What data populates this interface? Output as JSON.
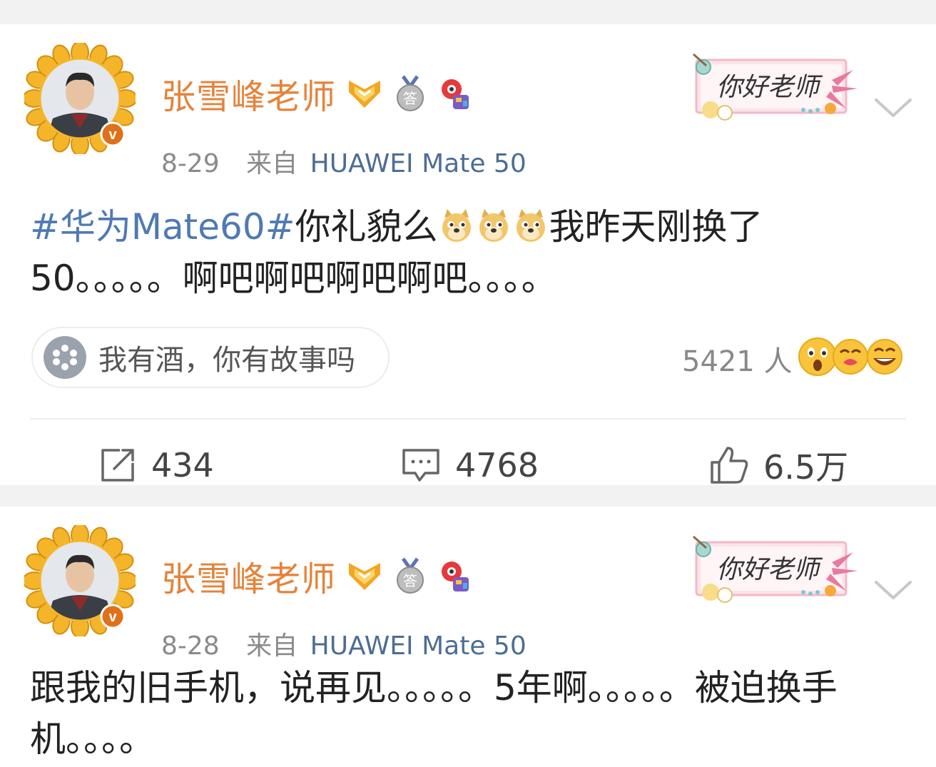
{
  "posts": [
    {
      "username": "张雪峰老师",
      "date": "8-29",
      "source_prefix": "来自",
      "device": "HUAWEI Mate 50",
      "text_hashtag": "#华为Mate60#",
      "text_part1": "你礼貌么",
      "text_part2": "我昨天刚换了50。。。。。啊吧啊吧啊吧啊吧。。。。",
      "sticker_text": "你好老师",
      "tag_text": "我有酒，你有故事吗",
      "reaction_count": "5421 人",
      "repost_count": "434",
      "comment_count": "4768",
      "like_count": "6.5万"
    },
    {
      "username": "张雪峰老师",
      "date": "8-28",
      "source_prefix": "来自",
      "device": "HUAWEI Mate 50",
      "text": "跟我的旧手机，说再见。。。。。5年啊。。。。。被迫换手机。。。。",
      "sticker_text": "你好老师"
    }
  ],
  "colors": {
    "username": "#e5833a",
    "hashtag": "#4f7ab3",
    "device": "#4c6d94",
    "meta": "#8a8a8a"
  },
  "icons": [
    "gold-badge-icon",
    "answer-medal-icon",
    "mascot-icon",
    "doge-emoji-icon",
    "chevron-down-icon",
    "tag-icon",
    "repost-icon",
    "comment-icon",
    "like-icon"
  ]
}
